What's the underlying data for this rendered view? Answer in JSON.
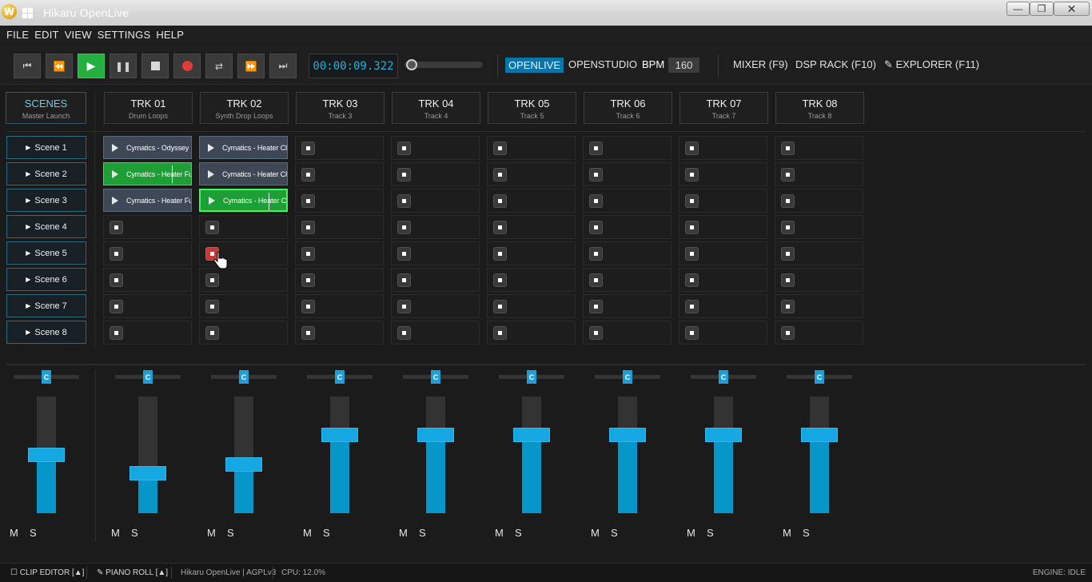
{
  "window": {
    "logo": "W",
    "title": "Hikaru OpenLive",
    "buttons": {
      "minimize": "—",
      "maximize": "❐",
      "close": "✕"
    }
  },
  "menu": [
    "FILE",
    "EDIT",
    "VIEW",
    "SETTINGS",
    "HELP"
  ],
  "transport": {
    "buttons": [
      {
        "name": "skip-to-start",
        "icon": "skip-back-icon",
        "glyph": "⏮"
      },
      {
        "name": "rewind",
        "icon": "rewind-icon",
        "glyph": "⏪"
      },
      {
        "name": "play",
        "icon": "play-icon",
        "glyph": "▶"
      },
      {
        "name": "pause",
        "icon": "pause-icon",
        "glyph": "❚❚"
      },
      {
        "name": "stop",
        "icon": "stop-icon",
        "glyph": ""
      },
      {
        "name": "record",
        "icon": "record-icon",
        "glyph": ""
      },
      {
        "name": "loop",
        "icon": "loop-icon",
        "glyph": "⇄"
      },
      {
        "name": "fast-forward",
        "icon": "fast-forward-icon",
        "glyph": "⏩"
      },
      {
        "name": "skip-to-end",
        "icon": "skip-forward-icon",
        "glyph": "⏭"
      }
    ],
    "time": "00:00:09.322",
    "position": 0.02,
    "play_active": true
  },
  "modes": {
    "openlive": "OPENLIVE",
    "openstudio": "OPENSTUDIO",
    "active": "OPENLIVE"
  },
  "bpm": {
    "label": "BPM",
    "value": "160"
  },
  "views": {
    "mixer": "MIXER (F9)",
    "dsp": "DSP RACK (F10)",
    "explorer": "✎ EXPLORER (F11)"
  },
  "scenes_header": {
    "title": "SCENES",
    "subtitle": "Master Launch"
  },
  "tracks": [
    {
      "title": "TRK 01",
      "subtitle": "Drum Loops"
    },
    {
      "title": "TRK 02",
      "subtitle": "Synth Drop Loops"
    },
    {
      "title": "TRK 03",
      "subtitle": "Track 3"
    },
    {
      "title": "TRK 04",
      "subtitle": "Track 4"
    },
    {
      "title": "TRK 05",
      "subtitle": "Track 5"
    },
    {
      "title": "TRK 06",
      "subtitle": "Track 6"
    },
    {
      "title": "TRK 07",
      "subtitle": "Track 7"
    },
    {
      "title": "TRK 08",
      "subtitle": "Track 8"
    }
  ],
  "scenes": [
    "Scene 1",
    "Scene 2",
    "Scene 3",
    "Scene 4",
    "Scene 5",
    "Scene 6",
    "Scene 7",
    "Scene 8"
  ],
  "clips": [
    {
      "track": 0,
      "scene": 0,
      "label": "Cymatics - Odyssey Futu",
      "state": "idle"
    },
    {
      "track": 1,
      "scene": 0,
      "label": "Cymatics - Heater Chord",
      "state": "idle"
    },
    {
      "track": 0,
      "scene": 1,
      "label": "Cymatics - Heater Full D",
      "state": "playing",
      "progress": 0.77
    },
    {
      "track": 1,
      "scene": 1,
      "label": "Cymatics - Heater Chord",
      "state": "idle"
    },
    {
      "track": 0,
      "scene": 2,
      "label": "Cymatics - Heater Full D",
      "state": "idle"
    },
    {
      "track": 1,
      "scene": 2,
      "label": "Cymatics - Heater Chord",
      "state": "playing-selected",
      "progress": 0.77
    }
  ],
  "armed_slot": {
    "track": 1,
    "scene": 4
  },
  "mixer": {
    "pan_label": "C",
    "mute_label": "M",
    "solo_label": "S",
    "strips": [
      {
        "name": "master",
        "pan": 0.5,
        "level": 0.5
      },
      {
        "name": "trk-01",
        "pan": 0.5,
        "level": 0.34
      },
      {
        "name": "trk-02",
        "pan": 0.5,
        "level": 0.42
      },
      {
        "name": "trk-03",
        "pan": 0.5,
        "level": 0.67
      },
      {
        "name": "trk-04",
        "pan": 0.5,
        "level": 0.67
      },
      {
        "name": "trk-05",
        "pan": 0.5,
        "level": 0.67
      },
      {
        "name": "trk-06",
        "pan": 0.5,
        "level": 0.67
      },
      {
        "name": "trk-07",
        "pan": 0.5,
        "level": 0.67
      },
      {
        "name": "trk-08",
        "pan": 0.5,
        "level": 0.67
      }
    ]
  },
  "statusbar": {
    "clip_editor": "☐ CLIP EDITOR [▲]",
    "piano_roll": "✎ PIANO ROLL [▲]",
    "about": "Hikaru OpenLive | AGPLv3",
    "cpu": "CPU: 12.0%",
    "engine": "ENGINE: IDLE"
  },
  "colors": {
    "accent": "#1e9fd8",
    "clip_idle": "#3e4756",
    "clip_playing": "#1d9f36",
    "armed": "#c43a3a",
    "play_button": "#23b040"
  }
}
